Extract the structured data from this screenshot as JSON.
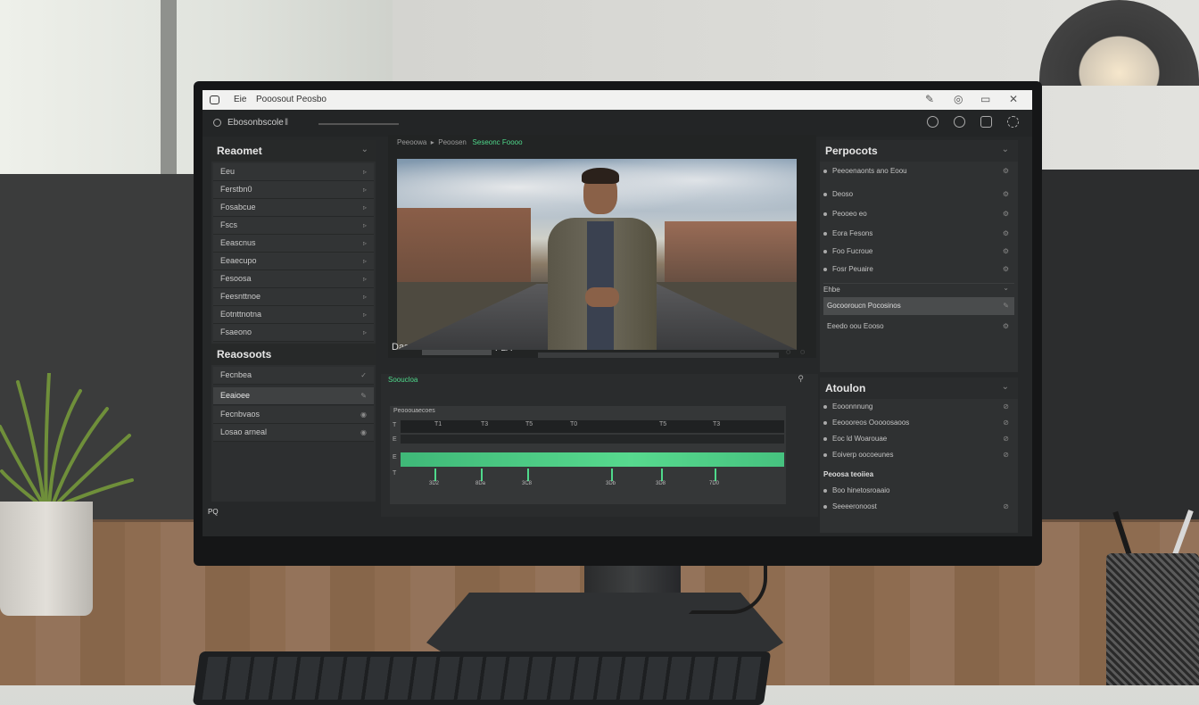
{
  "titlebar": {
    "menu_item": "Eie",
    "title": "Pooosout Peosbo",
    "controls": [
      "✎",
      "◎",
      "▭",
      "✕"
    ]
  },
  "toolbar": {
    "project_label": "Ebosonbscole",
    "project_suffix": "ǁ",
    "right_icons": [
      "heart-outline-icon",
      "circle-icon",
      "lock-icon",
      "gear-icon"
    ]
  },
  "left_panel": {
    "title": "Reaomet",
    "items": [
      "Eeu",
      "Ferstbn0",
      "Fosabcue",
      "Fscs",
      "Eeascnus",
      "Eeaecupo",
      "Fesoosa",
      "Feesnttnoe",
      "Eotnttnotna",
      "Fsaeono"
    ],
    "section2_title": "Reaosoots",
    "section2_items": [
      "Fecnbea",
      "Eeaioee",
      "Fecnbvaos",
      "Losao arneal"
    ],
    "footer": "PQ"
  },
  "viewer": {
    "breadcrumb": [
      "Peeoowa",
      "Peoosen",
      "Seseonc Foooo"
    ],
    "time_label": "Dasa",
    "time_value": "P2A"
  },
  "timeline": {
    "header": "Sooucloa",
    "sub_header": "Peooouaecoes",
    "ruler_ticks": [
      "T1",
      "T3",
      "T5",
      "T0",
      "T5",
      "T3"
    ],
    "track_labels": [
      "T",
      "E",
      "E",
      "T"
    ],
    "marker_labels": [
      "3D2",
      "8Da",
      "3C8",
      "3Db",
      "3D8",
      "7D0"
    ]
  },
  "right_panel": {
    "title": "Perpocots",
    "items": [
      "Peeoenaonts ano Eoou",
      "Deoso",
      "Peooeo eo",
      "Eora Fesons",
      "Foo Fucroue",
      "Fosr Peuaire"
    ],
    "subheader": "Ehbe",
    "selected_item": "Gocooroucn Pocosinos",
    "extra_item": "Eeedo oou Eooso"
  },
  "audio_panel": {
    "title": "Atoulon",
    "items": [
      "Eooonnnung",
      "Eeoooreos Ooooosaoos",
      "Eoc ld Woarouae",
      "Eoiverp oocoeunes"
    ],
    "section_title": "Peoosa teoiiea",
    "section_items": [
      "Boo hinetosroaaio",
      "Seeeeronoost"
    ]
  }
}
